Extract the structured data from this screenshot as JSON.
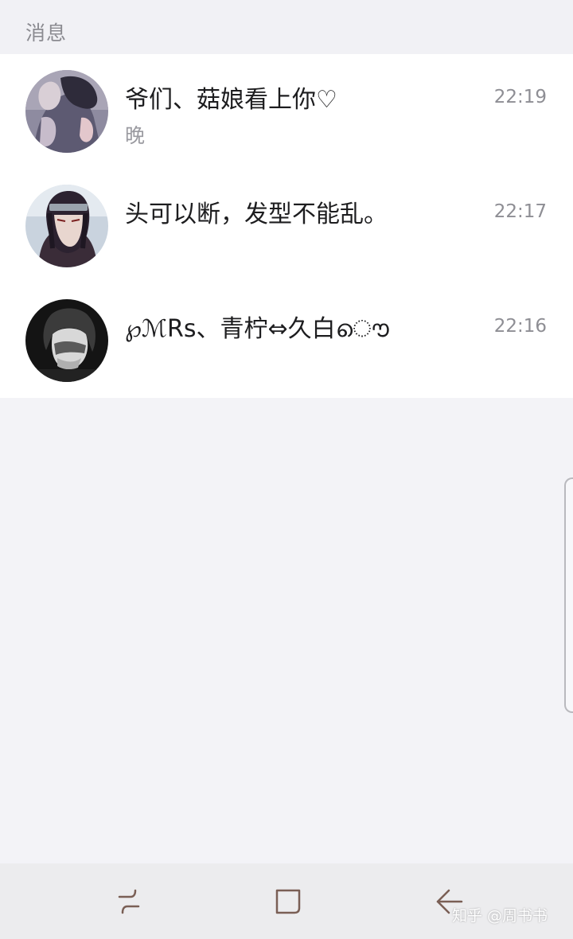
{
  "header": {
    "title": "消息"
  },
  "conversations": [
    {
      "name": "爷们、菇娘看上你♡",
      "preview": "晚",
      "time": "22:19",
      "avatar_icon": "avatar-anime-couple"
    },
    {
      "name": "头可以断，发型不能乱。",
      "preview": "",
      "time": "22:17",
      "avatar_icon": "avatar-anime-ninja"
    },
    {
      "name": "℘ℳRs、青柠⇔久白ൌ",
      "preview": "",
      "time": "22:16",
      "avatar_icon": "avatar-monochrome-photo"
    }
  ],
  "navbar": {
    "recent_icon": "recent-apps-icon",
    "home_icon": "home-icon",
    "back_icon": "back-arrow-icon"
  },
  "watermark": "知乎 @周书书",
  "colors": {
    "background": "#f3f3f7",
    "list_background": "#ffffff",
    "text_primary": "#1d1d1f",
    "text_secondary": "#8e8e94",
    "navbar": "#ececee",
    "nav_icon": "#7a5f55"
  }
}
